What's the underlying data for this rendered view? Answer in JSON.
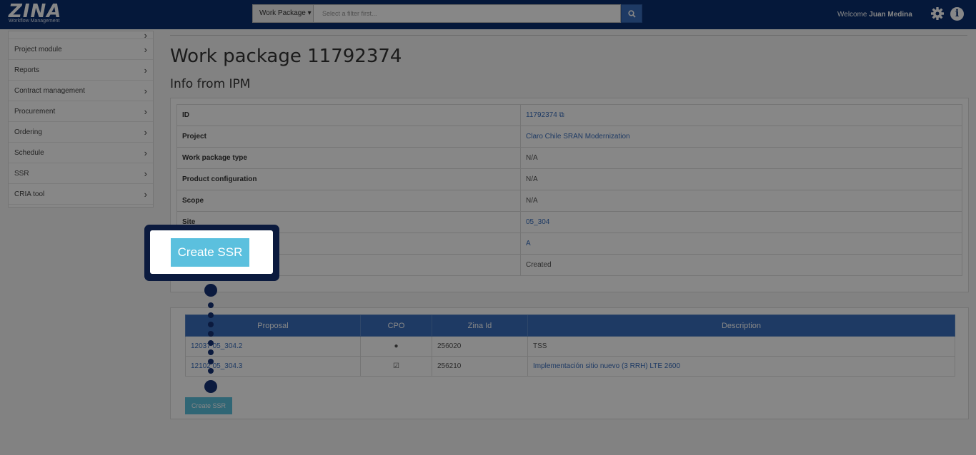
{
  "app": {
    "brand": "ZINA",
    "tagline": "Workflow Management"
  },
  "search": {
    "dropdown_label": "Work Package ▾",
    "placeholder": "Select a filter first..."
  },
  "user": {
    "welcome_prefix": "Welcome",
    "name": "Juan Medina"
  },
  "sidebar": {
    "items": [
      {
        "label": ""
      },
      {
        "label": "Project module"
      },
      {
        "label": "Reports"
      },
      {
        "label": "Contract management"
      },
      {
        "label": "Procurement"
      },
      {
        "label": "Ordering"
      },
      {
        "label": "Schedule"
      },
      {
        "label": "SSR"
      },
      {
        "label": "CRIA tool"
      }
    ]
  },
  "main": {
    "title": "Work package 11792374",
    "subtitle": "Info from IPM",
    "info_rows": [
      {
        "key": "ID",
        "value": "11792374 ⧉"
      },
      {
        "key": "Project",
        "value": "Claro Chile SRAN Modernization"
      },
      {
        "key": "Work package type",
        "value": "N/A"
      },
      {
        "key": "Product configuration",
        "value": "N/A"
      },
      {
        "key": "Scope",
        "value": "N/A"
      },
      {
        "key": "Site",
        "value": "05_304"
      },
      {
        "key": "",
        "value": "A"
      },
      {
        "key": "",
        "value": "Created"
      }
    ],
    "proposals": {
      "headers": [
        "Proposal",
        "CPO",
        "Zina Id",
        "Description"
      ],
      "rows": [
        {
          "proposal": "12037 05_304.2",
          "cpo": "●",
          "zina_id": "256020",
          "description": "TSS"
        },
        {
          "proposal": "12102 05_304.3",
          "cpo": "☑",
          "zina_id": "256210",
          "description": "Implementación sitio nuevo (3 RRH) LTE 2600"
        }
      ]
    },
    "create_button": "Create SSR"
  },
  "callout": {
    "button_label": "Create SSR"
  }
}
